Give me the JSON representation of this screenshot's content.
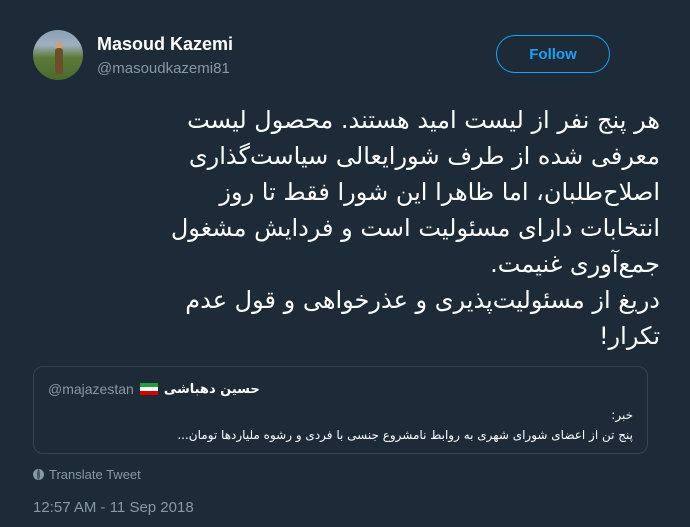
{
  "author": {
    "name": "Masoud Kazemi",
    "handle": "@masoudkazemi81"
  },
  "follow_label": "Follow",
  "tweet": {
    "text": "هر پنج نفر از لیست امید هستند. محصول لیست\nمعرفی شده از طرف شورایعالی سیاست‌گذاری\nاصلاح‌طلبان، اما ظاهرا این شورا فقط تا روز\nانتخابات دارای مسئولیت است و فردایش مشغول\nجمع‌آوری غنیمت.\nدریغ از مسئولیت‌پذیری و عذرخواهی و قول عدم\nتکرار!"
  },
  "quote": {
    "handle": "@majazestan",
    "name": "حسین دهباشی",
    "flag": "iran-flag-icon",
    "text": "خبر:\nپنج تن از اعضای شورای شهری به روابط نامشروع جنسی با فردی و رشوه ملیاردها تومان..."
  },
  "translate_label": "Translate Tweet",
  "timestamp": "12:57 AM - 11 Sep 2018",
  "colors": {
    "background": "#1d2a37",
    "accent": "#1da1f2",
    "muted": "#8899a6",
    "border": "#38444d"
  }
}
